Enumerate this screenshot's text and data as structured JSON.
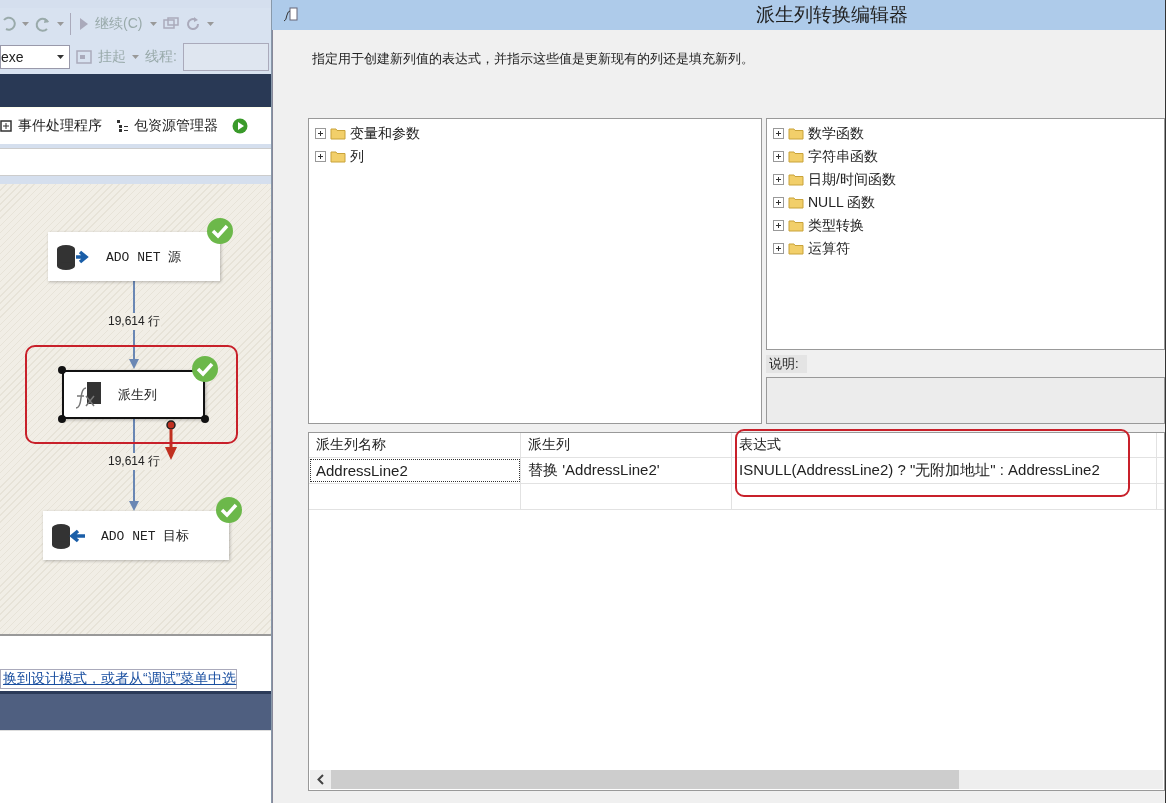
{
  "ide": {
    "toolbar": {
      "continue": {
        "label": "继续(C)",
        "disabled": true
      }
    },
    "debug_bar": {
      "process": "exe",
      "suspend": {
        "label": "挂起",
        "disabled": true
      },
      "thread_label": "线程:"
    },
    "designer_tabs": [
      {
        "label": "事件处理程序",
        "kind": "events"
      },
      {
        "label": "包资源管理器",
        "kind": "explorer"
      }
    ],
    "dataflow": {
      "nodes": [
        {
          "label": "ADO NET 源",
          "kind": "source",
          "valid": true,
          "selected": false
        },
        {
          "label": "派生列",
          "kind": "derived",
          "valid": true,
          "selected": true
        },
        {
          "label": "ADO NET 目标",
          "kind": "destination",
          "valid": true,
          "selected": false
        }
      ],
      "paths": [
        {
          "label": "19,614 行"
        },
        {
          "label": "19,614 行"
        }
      ]
    },
    "status_link": "换到设计模式，或者从“调试”菜单中选"
  },
  "dialog": {
    "title": "派生列转换编辑器",
    "description": "指定用于创建新列值的表达式，并指示这些值是更新现有的列还是填充新列。",
    "left_tree": [
      {
        "label": "变量和参数",
        "expanded": false
      },
      {
        "label": "列",
        "expanded": false
      }
    ],
    "right_tree": [
      {
        "label": "数学函数",
        "expanded": false
      },
      {
        "label": "字符串函数",
        "expanded": false
      },
      {
        "label": "日期/时间函数",
        "expanded": false
      },
      {
        "label": "NULL 函数",
        "expanded": false
      },
      {
        "label": "类型转换",
        "expanded": false
      },
      {
        "label": "运算符",
        "expanded": false
      }
    ],
    "help_label": "说明:",
    "grid": {
      "columns": [
        "派生列名称",
        "派生列",
        "表达式"
      ],
      "rows": [
        [
          "AddressLine2",
          "替换 'AddressLine2'",
          "ISNULL(AddressLine2) ? \"无附加地址\" : AddressLine2"
        ]
      ]
    }
  }
}
